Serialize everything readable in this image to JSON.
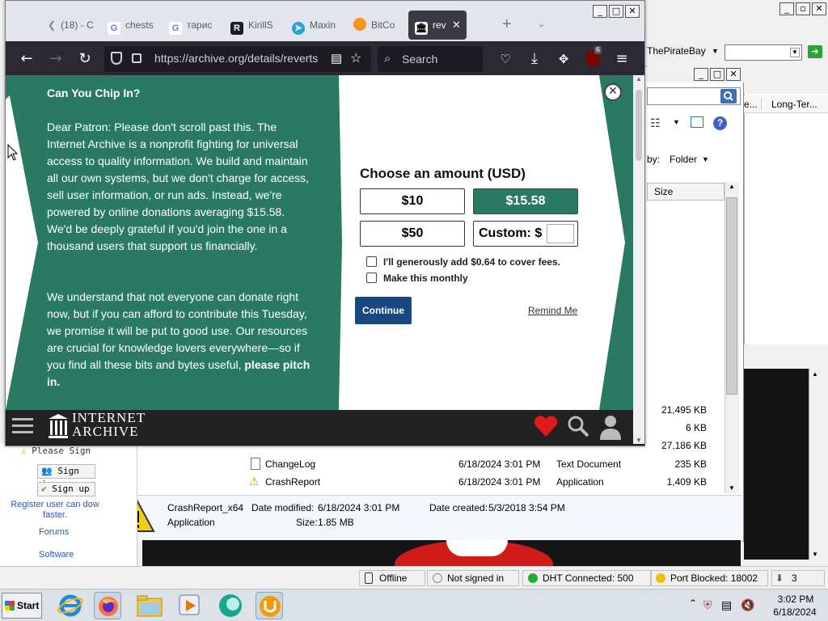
{
  "firefox": {
    "tabs": [
      {
        "label": "(18) - C",
        "icon": "back-arrow-icon"
      },
      {
        "label": "chests",
        "icon": "google-icon"
      },
      {
        "label": "тарис",
        "icon": "google-icon"
      },
      {
        "label": "KirillS",
        "icon": "r-app-icon"
      },
      {
        "label": "Maxin",
        "icon": "telegram-icon"
      },
      {
        "label": "BitCo",
        "icon": "bitcoin-icon"
      },
      {
        "label": "rev",
        "icon": "archive-icon"
      }
    ],
    "new_tab": "+",
    "url": "https://archive.org/details/reverts",
    "search_placeholder": "Search",
    "extension_badge": "6",
    "window_buttons": [
      "_",
      "□",
      "✕"
    ]
  },
  "banner": {
    "heading": "Can You Chip In?",
    "para1": "Dear Patron: Please don't scroll past this. The Internet Archive is a nonprofit fighting for universal access to quality information. We build and maintain all our own systems, but we don't charge for access, sell user information, or run ads. Instead, we're powered by online donations averaging $15.58. We'd be deeply grateful if you'd join the one in a thousand users that support us financially.",
    "para2_start": "We understand that not everyone can donate right now, but if you can afford to contribute this Tuesday, we promise it will be put to good use. Our resources are crucial for knowledge lovers everywhere—so if you find all these bits and bytes useful, ",
    "para2_bold": "please pitch in.",
    "choose_title": "Choose an amount (USD)",
    "amounts": [
      "$10",
      "$15.58",
      "$50"
    ],
    "custom_label": "Custom: $",
    "fee_checkbox": "I'll generously add $0.64 to cover fees.",
    "monthly_checkbox": "Make this monthly",
    "continue": "Continue",
    "remind": "Remind Me",
    "close": "✕",
    "colors": {
      "green": "#2a7a63",
      "blue": "#194880"
    }
  },
  "ia_footer": {
    "logo_line1": "INTERNET",
    "logo_line2": "ARCHIVE"
  },
  "background": {
    "toolbar_select": "ThePirateBay",
    "right_header": [
      "e...",
      "Long-Ter..."
    ],
    "sort_label": "by:",
    "sort_value": "Folder",
    "size_header": "Size",
    "upper_sizes": [
      "21,495 KB",
      "6 KB",
      "27,186 KB"
    ],
    "files": [
      {
        "name": "ChangeLog",
        "date": "6/18/2024 3:01 PM",
        "type": "Text Document",
        "size": "235 KB",
        "icon": "document-icon"
      },
      {
        "name": "CrashReport",
        "date": "6/18/2024 3:01 PM",
        "type": "Application",
        "size": "1,409 KB",
        "icon": "warning-icon"
      }
    ],
    "details": {
      "name": "CrashReport_x64",
      "type": "Application",
      "modified_label": "Date modified:",
      "modified": "6/18/2024 3:01 PM",
      "size_label": "Size:",
      "size": "1.85 MB",
      "created_label": "Date created:",
      "created": "5/3/2018 3:54 PM"
    },
    "side": {
      "please_sign": "Please Sign",
      "sign_in": "Sign in",
      "sign_up": "Sign up",
      "register": "Register user can dow faster.",
      "forums": "Forums",
      "software": "Software"
    }
  },
  "statusbar": {
    "offline": "Offline",
    "not_signed": "Not signed in",
    "dht": "DHT Connected: 500",
    "port": "Port Blocked: 18002",
    "count": "3"
  },
  "taskbar": {
    "start": "Start",
    "time": "3:02 PM",
    "date": "6/18/2024",
    "up_arrow": "⌃"
  }
}
